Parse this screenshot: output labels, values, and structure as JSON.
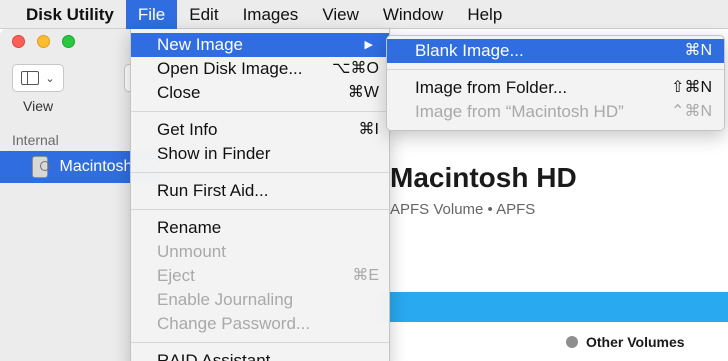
{
  "menubar": {
    "app_name": "Disk Utility",
    "items": [
      "File",
      "Edit",
      "Images",
      "View",
      "Window",
      "Help"
    ]
  },
  "toolbar": {
    "view_label": "View"
  },
  "sidebar": {
    "section_label": "Internal",
    "volume_label": "Macintosh HD"
  },
  "main": {
    "title": "Macintosh HD",
    "subtitle": "APFS Volume • APFS",
    "legend_label": "Other Volumes"
  },
  "file_menu": {
    "new_image": {
      "label": "New Image"
    },
    "open_disk_image": {
      "label": "Open Disk Image...",
      "shortcut": "⌥⌘O"
    },
    "close": {
      "label": "Close",
      "shortcut": "⌘W"
    },
    "get_info": {
      "label": "Get Info",
      "shortcut": "⌘I"
    },
    "show_in_finder": {
      "label": "Show in Finder"
    },
    "run_first_aid": {
      "label": "Run First Aid..."
    },
    "rename": {
      "label": "Rename"
    },
    "unmount": {
      "label": "Unmount"
    },
    "eject": {
      "label": "Eject",
      "shortcut": "⌘E"
    },
    "enable_journaling": {
      "label": "Enable Journaling"
    },
    "change_password": {
      "label": "Change Password..."
    },
    "raid_assistant": {
      "label": "RAID Assistant..."
    }
  },
  "new_image_submenu": {
    "blank_image": {
      "label": "Blank Image...",
      "shortcut": "⌘N"
    },
    "image_from_folder": {
      "label": "Image from Folder...",
      "shortcut": "⇧⌘N"
    },
    "image_from_volume": {
      "label": "Image from “Macintosh HD”",
      "shortcut": "⌃⌘N"
    }
  },
  "colors": {
    "selection": "#2f6de1",
    "usage_bar": "#29a9f0",
    "legend_dot": "#8e8e8e"
  }
}
